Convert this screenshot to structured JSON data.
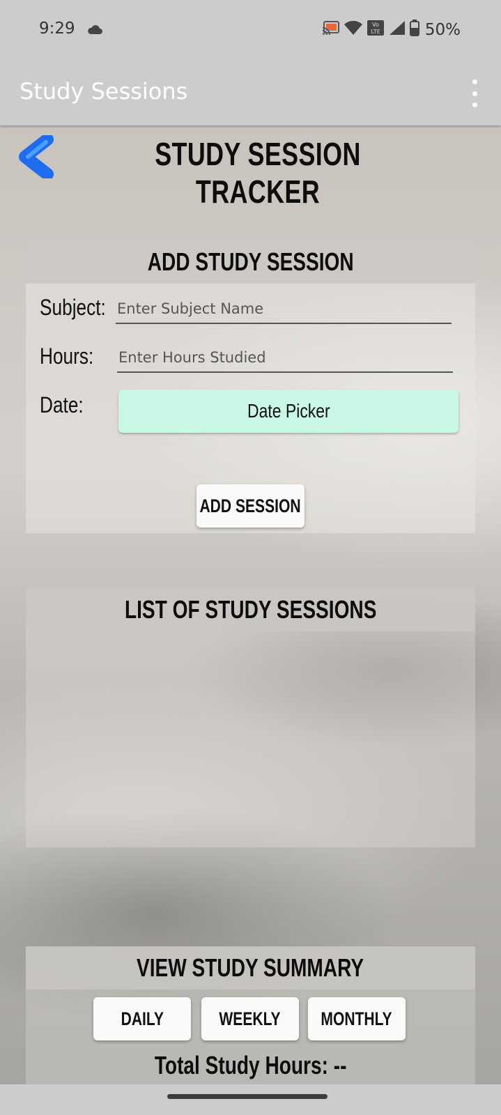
{
  "status_bar": {
    "time": "9:29",
    "battery": "50%",
    "icons": [
      "cloud-icon",
      "cast-icon",
      "wifi-icon",
      "volte-icon",
      "signal-icon",
      "battery-icon"
    ]
  },
  "app_bar": {
    "title": "Study Sessions",
    "menu_icon": "overflow-menu-icon"
  },
  "page": {
    "title": "STUDY SESSION TRACKER",
    "back_icon": "back-chevron-icon",
    "accent_color": "#1e6cf0"
  },
  "add_session": {
    "header": "ADD STUDY SESSION",
    "subject_label": "Subject:",
    "subject_placeholder": "Enter Subject Name",
    "hours_label": "Hours:",
    "hours_placeholder": "Enter Hours Studied",
    "date_label": "Date:",
    "date_picker_label": "Date Picker",
    "date_picker_color": "#c9f7e6",
    "add_button": "ADD SESSION"
  },
  "sessions_list": {
    "header": "LIST OF STUDY SESSIONS",
    "items": []
  },
  "summary": {
    "header": "VIEW STUDY SUMMARY",
    "buttons": [
      "DAILY",
      "WEEKLY",
      "MONTHLY"
    ],
    "total_label": "Total Study Hours: --"
  }
}
